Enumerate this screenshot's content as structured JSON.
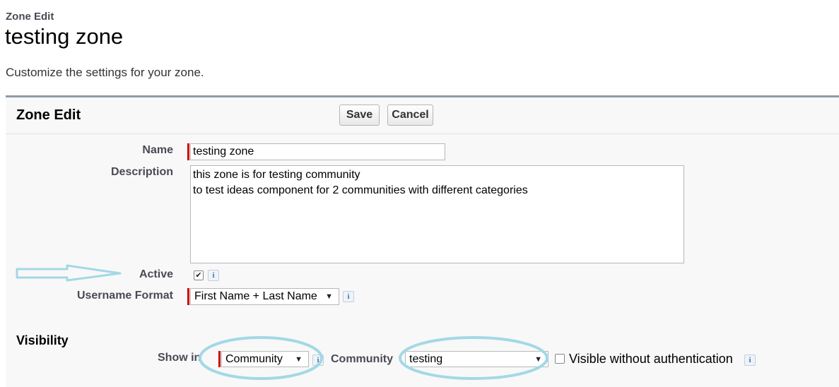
{
  "header": {
    "breadcrumb": "Zone Edit",
    "title": "testing zone",
    "subtitle": "Customize the settings for your zone."
  },
  "panel": {
    "title": "Zone Edit",
    "save_label": "Save",
    "cancel_label": "Cancel"
  },
  "form": {
    "name_label": "Name",
    "name_value": "testing zone",
    "description_label": "Description",
    "description_value": "this zone is for testing community\nto test ideas component for 2 communities with different categories",
    "active_label": "Active",
    "active_checked": true,
    "username_format_label": "Username Format",
    "username_format_value": "First Name + Last Name"
  },
  "visibility": {
    "section_title": "Visibility",
    "show_in_label": "Show in",
    "show_in_value": "Community",
    "community_label": "Community",
    "community_value": "testing",
    "visible_without_auth_label": "Visible without authentication",
    "visible_without_auth_checked": false
  },
  "icons": {
    "info": "i",
    "dropdown_arrow": "▼",
    "check": "✔"
  },
  "annotations": {
    "highlight_color": "#a3d8e6"
  }
}
